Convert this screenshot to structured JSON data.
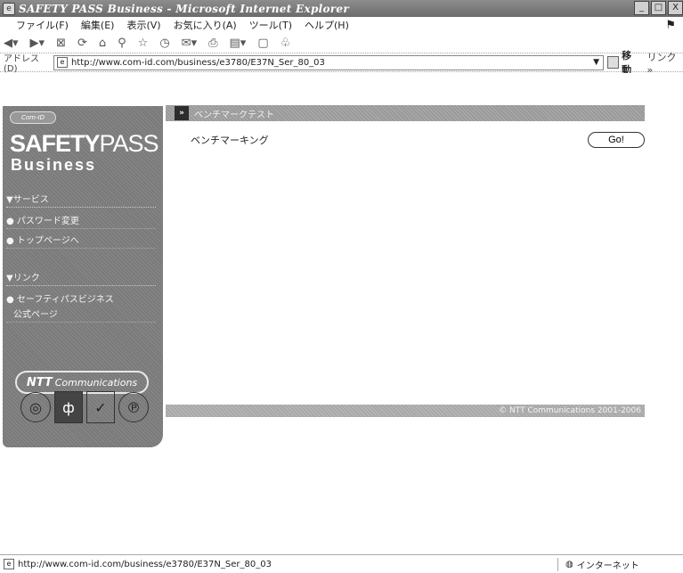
{
  "window": {
    "title": "SAFETY PASS Business - Microsoft Internet Explorer",
    "controls": [
      "_",
      "□",
      "X"
    ]
  },
  "menu": [
    "ファイル(F)",
    "編集(E)",
    "表示(V)",
    "お気に入り(A)",
    "ツール(T)",
    "ヘルプ(H)"
  ],
  "toolbar_icons": [
    "back-icon",
    "forward-icon",
    "stop-icon",
    "refresh-icon",
    "home-icon",
    "search-icon",
    "favorites-icon",
    "history-icon",
    "mail-icon",
    "print-icon",
    "edit-icon",
    "discuss-icon",
    "messenger-icon"
  ],
  "address": {
    "label": "アドレス(D)",
    "url": "http://www.com-id.com/business/e3780/E37N_Ser_80_03",
    "go_label": "移動",
    "links_label": "リンク »"
  },
  "sidebar": {
    "badge": "Com-ID",
    "brand_bold": "SAFETY",
    "brand_light": "PASS",
    "brand_sub": "Business",
    "section1_title": "▼サービス",
    "section1_links": [
      "● パスワード変更",
      "● トップページへ"
    ],
    "section2_title": "▼リンク",
    "section2_links": [
      "● セーフティパスビジネス",
      "公式ページ"
    ],
    "ntt_bold": "NTT",
    "ntt_rest": "Communications"
  },
  "main": {
    "header_badge": "»",
    "header_text": "ベンチマークテスト",
    "bench_label": "ベンチマーキング",
    "go_button": "Go!",
    "copyright": "© NTT Communications 2001-2006"
  },
  "status": {
    "url": "http://www.com-id.com/business/e3780/E37N_Ser_80_03",
    "zone": "インターネット"
  }
}
